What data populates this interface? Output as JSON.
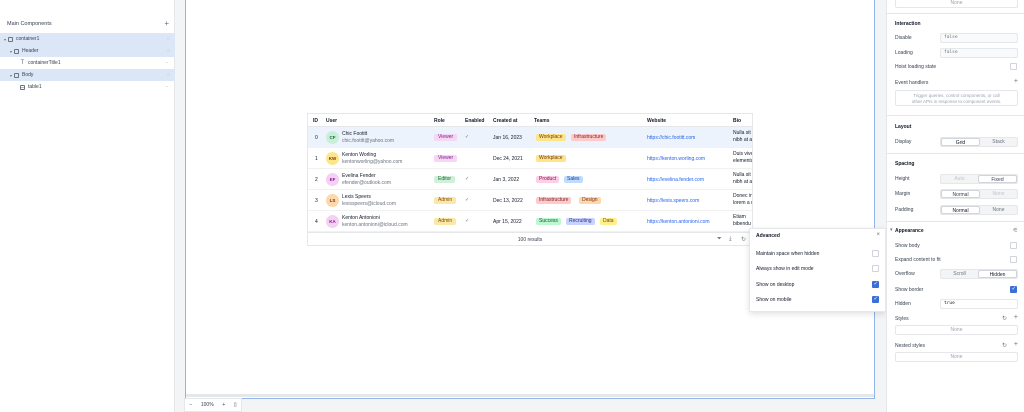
{
  "components_panel": {
    "title": "Main Components",
    "add_icon": "plus-icon",
    "tree": [
      {
        "label": "container1",
        "kind": "container",
        "selected": true
      },
      {
        "label": "Header",
        "kind": "container",
        "selected": true
      },
      {
        "label": "containerTitle1",
        "kind": "text",
        "selected": false
      },
      {
        "label": "Body",
        "kind": "container",
        "selected": true
      },
      {
        "label": "table1",
        "kind": "table",
        "selected": false
      }
    ]
  },
  "table": {
    "columns": [
      "ID",
      "User",
      "Role",
      "Enabled",
      "Created at",
      "Teams",
      "Website",
      "Bio"
    ],
    "rows": [
      {
        "id": "0",
        "initials": "CF",
        "avatar_bg": "#c9efd9",
        "avatar_fg": "#166534",
        "name": "Chic Footitt",
        "email": "chic.footitt@yahoo.com",
        "role": "Viewer",
        "role_kind": "viewer",
        "enabled": "✓",
        "created": "Jan 16, 2023",
        "teams": [
          {
            "label": "Workplace",
            "kind": "workplace"
          },
          {
            "label": "Infrastructure",
            "kind": "infrastructure"
          }
        ],
        "website": "https://chic.footitt.com",
        "bio1": "Nulla sit",
        "bio2": "nibh at a"
      },
      {
        "id": "1",
        "initials": "KW",
        "avatar_bg": "#fde68a",
        "avatar_fg": "#78350f",
        "name": "Kenton Worling",
        "email": "kentonworling@yahoo.com",
        "role": "Viewer",
        "role_kind": "viewer",
        "enabled": "",
        "created": "Dec 24, 2021",
        "teams": [
          {
            "label": "Workplace",
            "kind": "workplace"
          }
        ],
        "website": "https://kenton.worling.com",
        "bio1": "Duis vive",
        "bio2": "elementu"
      },
      {
        "id": "2",
        "initials": "EF",
        "avatar_bg": "#f5d0f5",
        "avatar_fg": "#86198f",
        "name": "Evelina Fender",
        "email": "efender@outlook.com",
        "role": "Editor",
        "role_kind": "editor",
        "enabled": "✓",
        "created": "Jan 3, 2022",
        "teams": [
          {
            "label": "Product",
            "kind": "product"
          },
          {
            "label": "Sales",
            "kind": "sales"
          }
        ],
        "website": "https://evelina.fender.com",
        "bio1": "Nulla sit",
        "bio2": "nibh at a"
      },
      {
        "id": "3",
        "initials": "LS",
        "avatar_bg": "#fed7aa",
        "avatar_fg": "#7c2d12",
        "name": "Lexis Speers",
        "email": "lexisspeers@icloud.com",
        "role": "Admin",
        "role_kind": "admin",
        "enabled": "✓",
        "created": "Dec 13, 2022",
        "teams": [
          {
            "label": "Infrastructure",
            "kind": "infrastructure"
          },
          {
            "label": "Design",
            "kind": "design"
          }
        ],
        "website": "https://lexis.speers.com",
        "bio1": "Donec in",
        "bio2": "lorem a d"
      },
      {
        "id": "4",
        "initials": "KA",
        "avatar_bg": "#f5d0f5",
        "avatar_fg": "#86198f",
        "name": "Kenton Antonioni",
        "email": "kenton.antonioni@icloud.com",
        "role": "Admin",
        "role_kind": "admin",
        "enabled": "✓",
        "created": "Apr 15, 2022",
        "teams": [
          {
            "label": "Success",
            "kind": "success"
          },
          {
            "label": "Recruiting",
            "kind": "recruiting"
          },
          {
            "label": "Data",
            "kind": "data"
          }
        ],
        "website": "https://kenton.antonioni.com",
        "bio1": "Etiam",
        "bio2": "bibendu"
      }
    ],
    "footer": {
      "results": "100 results",
      "filter_icon": "filter-icon",
      "download_icon": "download-icon",
      "refresh_icon": "refresh-icon"
    }
  },
  "advanced_popover": {
    "title": "Advanced",
    "close_icon": "close-icon",
    "options": [
      {
        "label": "Maintain space when hidden",
        "checked": false
      },
      {
        "label": "Always show in edit mode",
        "checked": false
      },
      {
        "label": "Show on desktop",
        "checked": true
      },
      {
        "label": "Show on mobile",
        "checked": true
      }
    ]
  },
  "zoom": {
    "minus": "−",
    "level": "100%",
    "plus": "+",
    "device_icon": "mobile-icon"
  },
  "inspector": {
    "top_none": "None",
    "interaction": {
      "title": "Interaction",
      "disable_label": "Disable",
      "disable_value": "false",
      "loading_label": "Loading",
      "loading_value": "false",
      "hoist_label": "Hoist loading state",
      "event_handlers_label": "Event handlers",
      "event_handlers_hint_1": "Trigger queries, control components, or call",
      "event_handlers_hint_2": "other APIs in response to component events."
    },
    "layout": {
      "title": "Layout",
      "display_label": "Display",
      "display_options": [
        "Grid",
        "Stack"
      ],
      "display_selected": "Grid"
    },
    "spacing": {
      "title": "Spacing",
      "height_label": "Height",
      "height_options": [
        "Auto",
        "Fixed"
      ],
      "margin_label": "Margin",
      "margin_options": [
        "Normal",
        "None"
      ],
      "padding_label": "Padding",
      "padding_options": [
        "Normal",
        "None"
      ]
    },
    "appearance": {
      "title": "Appearance",
      "show_body_label": "Show body",
      "expand_label": "Expand content to fit",
      "overflow_label": "Overflow",
      "overflow_options": [
        "Scroll",
        "Hidden"
      ],
      "overflow_selected": "Hidden",
      "show_border_label": "Show border",
      "show_border_checked": true,
      "hidden_label": "Hidden",
      "hidden_value": "true",
      "styles_label": "Styles",
      "styles_value": "None",
      "nested_styles_label": "Nested styles",
      "nested_styles_value": "None"
    }
  },
  "colors": {
    "accent": "#3b6fd8",
    "selection": "#dbe7f6",
    "link": "#2563eb"
  }
}
